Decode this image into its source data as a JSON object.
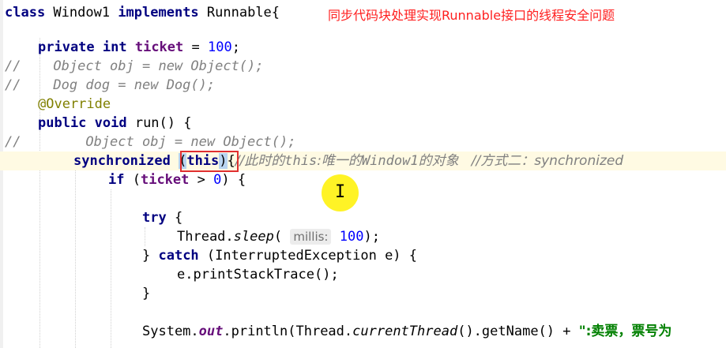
{
  "annotation": "同步代码块处理实现Runnable接口的线程安全问题",
  "code": {
    "l1": {
      "kw1": "class",
      "name": " Window1 ",
      "kw2": "implements",
      "rest": " Runnable{"
    },
    "l3": {
      "kw": "private int",
      "field": "ticket",
      "eq": " = ",
      "num": "100",
      "semi": ";"
    },
    "l4": "//    Object obj = new Object();",
    "l5": "//    Dog dog = new Dog();",
    "l6": "@Override",
    "l7": {
      "kw": "public void",
      "rest": " run() {"
    },
    "l8": "//        Object obj = new Object();",
    "l9": {
      "kw": "synchronized",
      "lparen": "(",
      "this": "this",
      "rparen": ")",
      "brace": "{",
      "comment_prefix": "//此时的",
      "comment_this": "this",
      "comment_mid": ":唯一的",
      "comment_win": "Window1",
      "comment_end": "的对象   //方式二：synchronized"
    },
    "l10": {
      "kw": "if",
      "open": " (",
      "field": "ticket",
      "op": " > ",
      "num": "0",
      "close": ") {"
    },
    "l12": {
      "kw": "try",
      "rest": " {"
    },
    "l13": {
      "cls": "Thread.",
      "method": "sleep",
      "open": "( ",
      "hint": "millis:",
      "num": "100",
      "close": ");"
    },
    "l14": {
      "brace": "} ",
      "kw": "catch",
      "rest": " (InterruptedException e) {"
    },
    "l15": "e.printStackTrace();",
    "l16": "}",
    "l18": {
      "a": "System.",
      "out": "out",
      "b": ".println(Thread.",
      "ct": "currentThread",
      "c": "().getName() + ",
      "str": "\":卖票，票号为"
    }
  }
}
